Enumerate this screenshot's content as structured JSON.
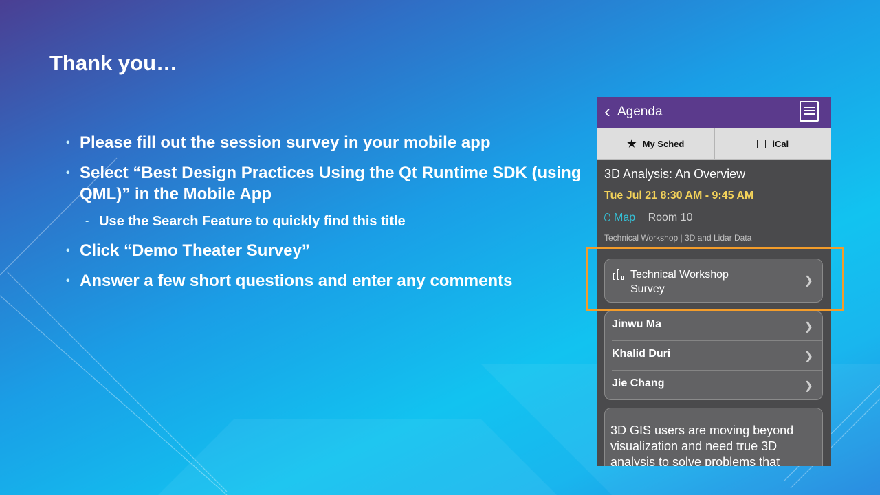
{
  "slide": {
    "title": "Thank you…",
    "bullets": [
      "Please fill out the session survey in your mobile app",
      "Select “Best Design Practices Using the Qt Runtime SDK (using QML)” in the Mobile App",
      "Click “Demo Theater Survey”",
      "Answer a few short questions and enter any comments"
    ],
    "sub_bullet": "Use the Search Feature to quickly find this title"
  },
  "app": {
    "nav_title": "Agenda",
    "tabs": [
      {
        "label": "My Sched",
        "icon": "star-icon"
      },
      {
        "label": "iCal",
        "icon": "calendar-icon"
      }
    ],
    "session": {
      "title": "3D Analysis: An Overview",
      "time": "Tue Jul 21 8:30 AM - 9:45 AM",
      "map_label": "Map",
      "room": "Room 10",
      "track": "Technical Workshop | 3D and Lidar Data"
    },
    "survey": {
      "line1": "Technical Workshop",
      "line2": "Survey"
    },
    "speakers": [
      "Jinwu Ma",
      "Khalid Duri",
      "Jie Chang"
    ],
    "description": "3D GIS users are moving beyond visualization and need true 3D analysis to solve problems that"
  },
  "colors": {
    "nav_purple": "#5b3a8c",
    "time_yellow": "#f3d25a",
    "map_teal": "#35c0d6",
    "highlight_orange": "#f39c2a"
  }
}
